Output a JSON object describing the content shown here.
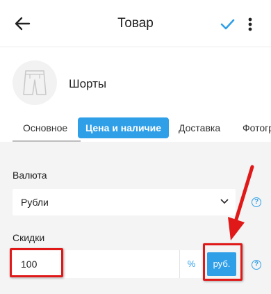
{
  "header": {
    "title": "Товар"
  },
  "product": {
    "name": "Шорты"
  },
  "tabs": [
    {
      "label": "Основное"
    },
    {
      "label": "Цена и наличие"
    },
    {
      "label": "Доставка"
    },
    {
      "label": "Фотогр"
    }
  ],
  "currency": {
    "label": "Валюта",
    "value": "Рубли"
  },
  "discount": {
    "label": "Скидки",
    "value": "100",
    "percent_label": "%",
    "rub_label": "руб."
  },
  "help_symbol": "?",
  "colors": {
    "accent": "#2f9fe8",
    "annotation": "#e01818"
  }
}
